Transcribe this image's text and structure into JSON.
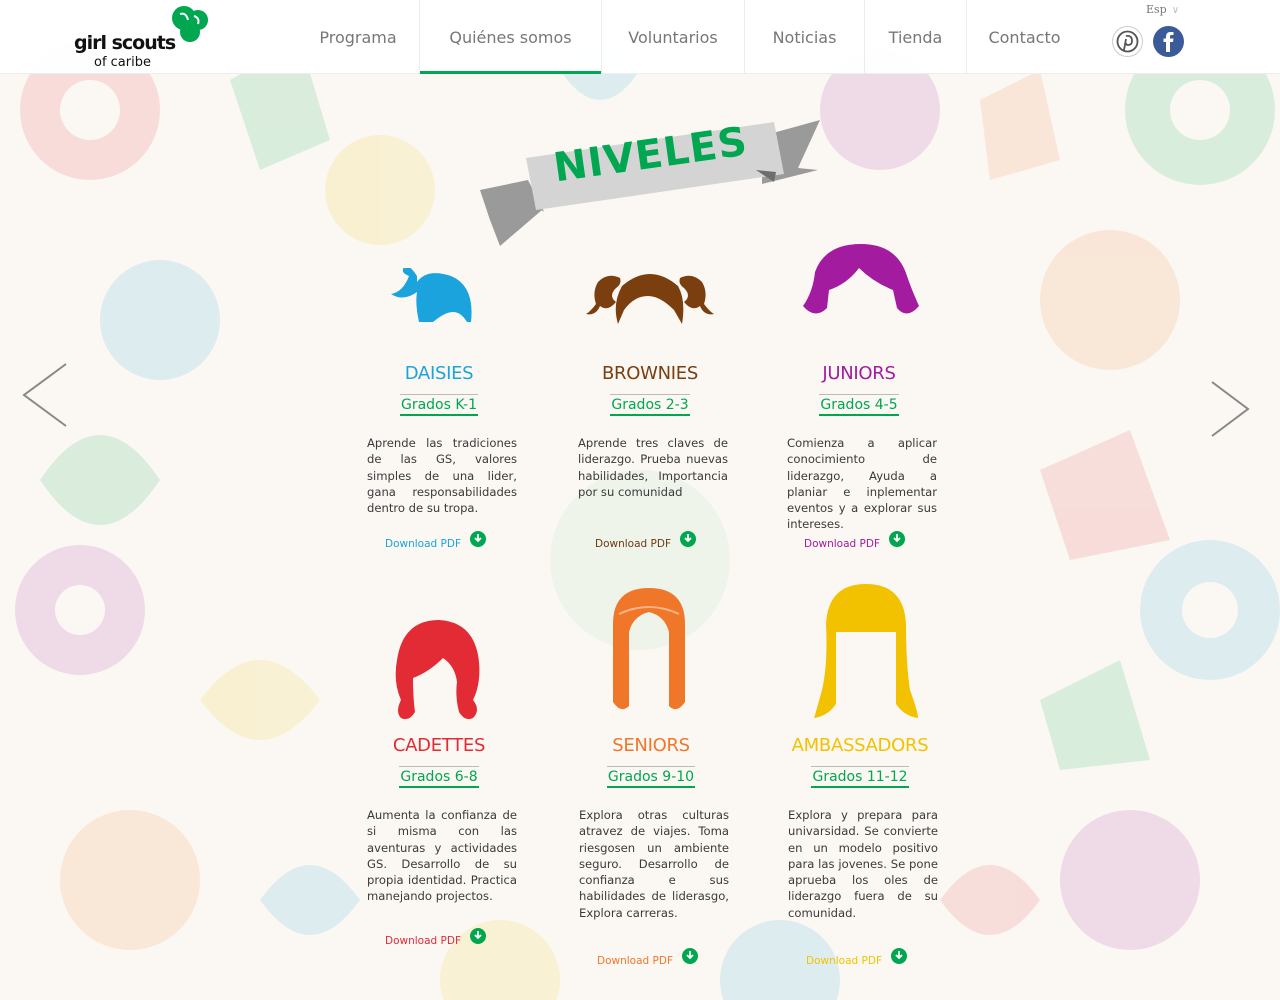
{
  "header": {
    "logo": {
      "line1": "girl scouts",
      "line2": "of caribe"
    },
    "nav": [
      {
        "label": "Programa",
        "active": false
      },
      {
        "label": "Quiénes somos",
        "active": true
      },
      {
        "label": "Voluntarios",
        "active": false
      },
      {
        "label": "Noticias",
        "active": false
      },
      {
        "label": "Tienda",
        "active": false
      },
      {
        "label": "Contacto",
        "active": false
      }
    ],
    "language": "Esp",
    "social": [
      "pinterest-icon",
      "facebook-icon"
    ]
  },
  "title": "NIVELES",
  "levels": [
    {
      "name": "DAISIES",
      "grades": "Grados K-1",
      "color": "#1aa3dc",
      "description": "Aprende las tradiciones de las GS, valores simples de una lider, gana responsabilidades dentro de su tropa.",
      "download": "Download PDF"
    },
    {
      "name": "BROWNIES",
      "grades": "Grados 2-3",
      "color": "#6b3a10",
      "description": "Aprende tres claves de liderazgo. Prueba nuevas habilidades, Importancia por su comunidad",
      "download": "Download PDF"
    },
    {
      "name": "JUNIORS",
      "grades": "Grados 4-5",
      "color": "#a31b9e",
      "description": "Comienza a aplicar conocimiento de liderazgo, Ayuda a planiar e inplementar eventos y a explorar sus intereses.",
      "download": "Download PDF"
    },
    {
      "name": "CADETTES",
      "grades": "Grados 6-8",
      "color": "#e32b36",
      "description": "Aumenta la confianza de si misma con las aventuras y actividades GS. Desarrollo de su propia identidad. Practica manejando projectos.",
      "download": "Download PDF"
    },
    {
      "name": "SENIORS",
      "grades": "Grados 9-10",
      "color": "#f0762a",
      "description": "Explora otras culturas atravez de viajes. Toma riesgosen un ambiente seguro. Desarrollo de confianza e sus habilidades de liderasgo, Explora carreras.",
      "download": "Download PDF"
    },
    {
      "name": "AMBASSADORS",
      "grades": "Grados 11-12",
      "color": "#f2c200",
      "description": "Explora y prepara para univarsidad. Se convierte en un modelo positivo para las jovenes. Se pone aprueba los oles de liderazgo fuera de su comunidad.",
      "download": "Download PDF"
    }
  ],
  "icons": {
    "prev": "chevron-left-icon",
    "next": "chevron-right-icon",
    "download": "download-arrow-icon"
  }
}
